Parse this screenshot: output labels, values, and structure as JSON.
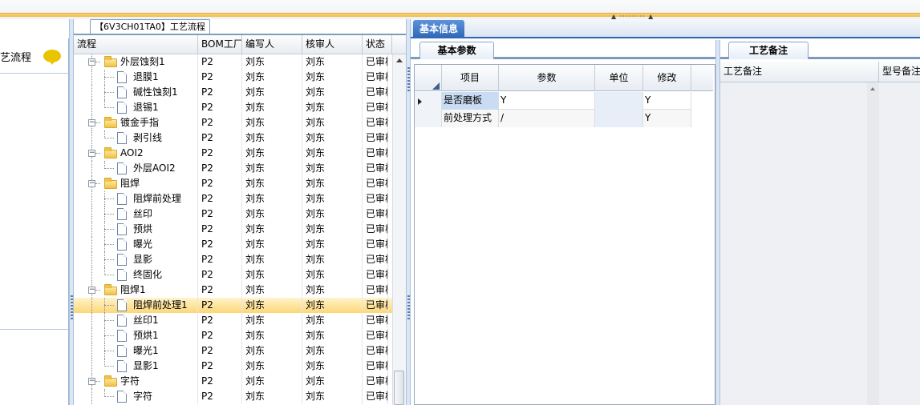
{
  "left_panel": {
    "label": "艺流程",
    "icon": "speech-bubble-icon"
  },
  "tree_panel": {
    "tab_label": "【6V3CH01TA0】工艺流程",
    "columns": [
      "流程",
      "BOM工厂",
      "编写人",
      "核审人",
      "状态"
    ],
    "rows": [
      {
        "name": "外层蚀刻1",
        "level": 1,
        "type": "folder",
        "bom": "P2",
        "writer": "刘东",
        "reviewer": "刘东",
        "status": "已审核"
      },
      {
        "name": "退膜1",
        "level": 2,
        "type": "doc",
        "bom": "P2",
        "writer": "刘东",
        "reviewer": "刘东",
        "status": "已审核"
      },
      {
        "name": "碱性蚀刻1",
        "level": 2,
        "type": "doc",
        "bom": "P2",
        "writer": "刘东",
        "reviewer": "刘东",
        "status": "已审核"
      },
      {
        "name": "退锡1",
        "level": 2,
        "type": "doc",
        "bom": "P2",
        "writer": "刘东",
        "reviewer": "刘东",
        "status": "已审核"
      },
      {
        "name": "镀金手指",
        "level": 1,
        "type": "folder",
        "bom": "P2",
        "writer": "刘东",
        "reviewer": "刘东",
        "status": "已审核"
      },
      {
        "name": "剥引线",
        "level": 2,
        "type": "doc",
        "bom": "P2",
        "writer": "刘东",
        "reviewer": "刘东",
        "status": "已审核"
      },
      {
        "name": "AOI2",
        "level": 1,
        "type": "folder",
        "bom": "P2",
        "writer": "刘东",
        "reviewer": "刘东",
        "status": "已审核"
      },
      {
        "name": "外层AOI2",
        "level": 2,
        "type": "doc",
        "bom": "P2",
        "writer": "刘东",
        "reviewer": "刘东",
        "status": "已审核"
      },
      {
        "name": "阻焊",
        "level": 1,
        "type": "folder",
        "bom": "P2",
        "writer": "刘东",
        "reviewer": "刘东",
        "status": "已审核"
      },
      {
        "name": "阻焊前处理",
        "level": 2,
        "type": "doc",
        "bom": "P2",
        "writer": "刘东",
        "reviewer": "刘东",
        "status": "已审核"
      },
      {
        "name": "丝印",
        "level": 2,
        "type": "doc",
        "bom": "P2",
        "writer": "刘东",
        "reviewer": "刘东",
        "status": "已审核"
      },
      {
        "name": "预烘",
        "level": 2,
        "type": "doc",
        "bom": "P2",
        "writer": "刘东",
        "reviewer": "刘东",
        "status": "已审核"
      },
      {
        "name": "曝光",
        "level": 2,
        "type": "doc",
        "bom": "P2",
        "writer": "刘东",
        "reviewer": "刘东",
        "status": "已审核"
      },
      {
        "name": "显影",
        "level": 2,
        "type": "doc",
        "bom": "P2",
        "writer": "刘东",
        "reviewer": "刘东",
        "status": "已审核"
      },
      {
        "name": "终固化",
        "level": 2,
        "type": "doc",
        "bom": "P2",
        "writer": "刘东",
        "reviewer": "刘东",
        "status": "已审核"
      },
      {
        "name": "阻焊1",
        "level": 1,
        "type": "folder",
        "bom": "P2",
        "writer": "刘东",
        "reviewer": "刘东",
        "status": "已审核"
      },
      {
        "name": "阻焊前处理1",
        "level": 2,
        "type": "doc",
        "bom": "P2",
        "writer": "刘东",
        "reviewer": "刘东",
        "status": "已审核",
        "selected": true
      },
      {
        "name": "丝印1",
        "level": 2,
        "type": "doc",
        "bom": "P2",
        "writer": "刘东",
        "reviewer": "刘东",
        "status": "已审核"
      },
      {
        "name": "预烘1",
        "level": 2,
        "type": "doc",
        "bom": "P2",
        "writer": "刘东",
        "reviewer": "刘东",
        "status": "已审核"
      },
      {
        "name": "曝光1",
        "level": 2,
        "type": "doc",
        "bom": "P2",
        "writer": "刘东",
        "reviewer": "刘东",
        "status": "已审核"
      },
      {
        "name": "显影1",
        "level": 2,
        "type": "doc",
        "bom": "P2",
        "writer": "刘东",
        "reviewer": "刘东",
        "status": "已审核"
      },
      {
        "name": "字符",
        "level": 1,
        "type": "folder",
        "bom": "P2",
        "writer": "刘东",
        "reviewer": "刘东",
        "status": "已审核"
      },
      {
        "name": "字符",
        "level": 2,
        "type": "doc",
        "bom": "P2",
        "writer": "刘东",
        "reviewer": "刘东",
        "status": "已审核"
      }
    ]
  },
  "info_tab": {
    "label": "基本信息"
  },
  "params_panel": {
    "tab_label": "基本参数",
    "columns": [
      "项目",
      "参数",
      "单位",
      "修改"
    ],
    "rows": [
      {
        "item": "是否磨板",
        "param": "Y",
        "unit": "",
        "modify": "Y",
        "current": true
      },
      {
        "item": "前处理方式",
        "param": "/",
        "unit": "",
        "modify": "Y",
        "current": false
      }
    ]
  },
  "remarks_panel": {
    "tab_label": "工艺备注",
    "columns": [
      "工艺备注",
      "型号备注"
    ]
  }
}
